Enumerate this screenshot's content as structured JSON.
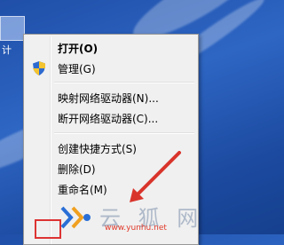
{
  "desktop": {
    "icon_label": "计"
  },
  "context_menu": {
    "items": [
      {
        "label": "打开(O)",
        "bold": true
      },
      {
        "label": "管理(G)",
        "icon": "uac-shield-icon"
      },
      {
        "label": "映射网络驱动器(N)..."
      },
      {
        "label": "断开网络驱动器(C)..."
      },
      {
        "label": "创建快捷方式(S)"
      },
      {
        "label": "删除(D)"
      },
      {
        "label": "重命名(M)"
      }
    ]
  },
  "watermark": {
    "text": "云 狐 网",
    "url": "www.yunhu.net",
    "logo": "yunhu-logo"
  },
  "colors": {
    "desktop_bg": "#2e66c4",
    "menu_bg": "#f0f0f0",
    "annotation_arrow": "#d9342b",
    "watermark_url": "#e13a2a"
  }
}
